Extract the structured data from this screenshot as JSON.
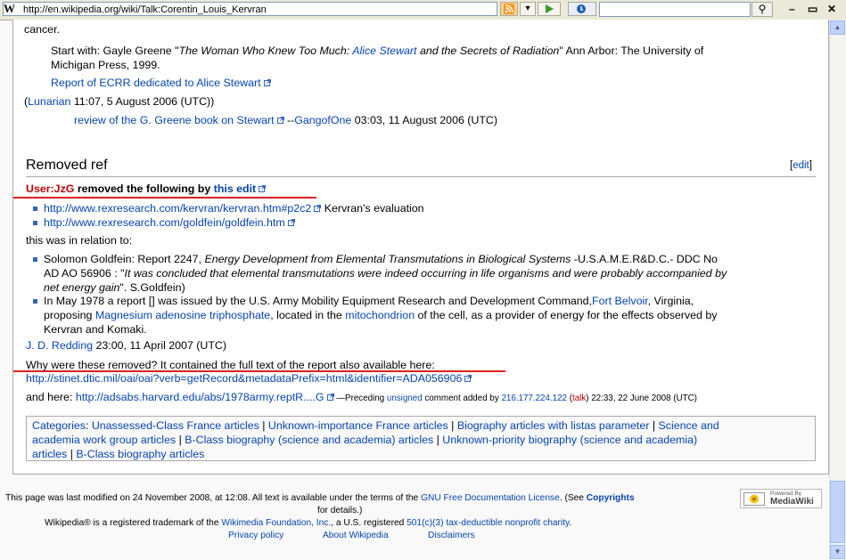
{
  "browser": {
    "url": "http://en.wikipedia.org/wiki/Talk:Corentin_Louis_Kervran",
    "favicon": "W"
  },
  "article": {
    "line_top": "cancer.",
    "start_with_prefix": "Start with: Gayle Greene \"",
    "book_title_1": "The Woman Who Knew Too Much: ",
    "alice_stewart": "Alice Stewart",
    "book_title_2": " and the Secrets of Radiation",
    "start_with_suffix": "\" Ann Arbor: The University of",
    "publisher_line": "Michigan Press, 1999.",
    "ecrr_link": "Report of ECRR dedicated to Alice Stewart",
    "sig1_open": "(",
    "sig1_user": "Lunarian",
    "sig1_rest": " 11:07, 5 August 2006 (UTC))",
    "review_link": "review of the G. Greene book on Stewart",
    "review_sep": " --",
    "review_user": "GangofOne",
    "review_time": " 03:03, 11 August 2006 (UTC)",
    "section_heading": "Removed ref",
    "edit_open": "[",
    "edit_label": "edit",
    "edit_close": "]",
    "removed_user": "User:JzG",
    "removed_text": " removed the following by ",
    "removed_link": "this edit",
    "link1": "http://www.rexresearch.com/kervran/kervran.htm#p2c2",
    "link1_suffix": " Kervran's evaluation",
    "link2": "http://www.rexresearch.com/goldfein/goldfein.htm",
    "relation": "this was in relation to:",
    "b1_l1_a": "Solomon Goldfein: Report 2247, ",
    "b1_l1_b": "Energy Development from Elemental Transmutations in Biological Systems",
    "b1_l1_c": " -U.S.A.M.E.R&D.C.- DDC No",
    "b1_l2_a": "AD AO 56906 : \"",
    "b1_l2_b": "It was concluded that elemental transmutations were indeed occurring in life organisms and were probably accompanied by",
    "b1_l3_a": "net energy gain",
    "b1_l3_b": "\". S.Goldfein)",
    "b2_l1_a": "In May 1978 a report [] was issued by the U.S. Army Mobility Equipment Research and Development Command,",
    "b2_l1_link": "Fort Belvoir",
    "b2_l1_b": ", Virginia,",
    "b2_l2_a": "proposing ",
    "b2_l2_link1": "Magnesium adenosine triphosphate",
    "b2_l2_b": ", located in the ",
    "b2_l2_link2": "mitochondrion",
    "b2_l2_c": " of the cell, as a provider of energy for the effects observed by",
    "b2_l3": "Kervran and Komaki.",
    "redding_user": "J. D. Redding",
    "redding_time": " 23:00, 11 April 2007 (UTC)",
    "why_text": "Why were these removed? It contained the full text of the report also available here:",
    "stinet_link": "http://stinet.dtic.mil/oai/oai?verb=getRecord&metadataPrefix=html&identifier=ADA056906",
    "and_here": "and here: ",
    "adsabs_link": "http://adsabs.harvard.edu/abs/1978army.reptR....G",
    "preceding": " —Preceding ",
    "unsigned": "unsigned",
    "comment_added": " comment added by ",
    "ip": "216.177.224.122",
    "talk_open": " (",
    "talk": "talk",
    "talk_close": ") 22:33, 22 June 2008 (UTC)"
  },
  "categories": {
    "label": "Categories",
    "colon": ": ",
    "line1": [
      "Unassessed-Class France articles",
      "Unknown-importance France articles",
      "Biography articles with listas parameter",
      "Science and"
    ],
    "line2": [
      "academia work group articles",
      "B-Class biography (science and academia) articles",
      "Unknown-priority biography (science and academia)"
    ],
    "line3": [
      "articles",
      "B-Class biography articles"
    ],
    "sep": " | "
  },
  "footer": {
    "l1_a": "This page was last modified on 24 November 2008, at 12:08.  All text is available under the terms of the ",
    "l1_link": "GNU Free Documentation License",
    "l1_b": ". (See ",
    "l1_bold": "Copyrights",
    "l2": "for details.)",
    "l3_a": "Wikipedia® is a registered trademark of the ",
    "l3_link1": "Wikimedia Foundation, Inc.",
    "l3_b": ", a U.S. registered ",
    "l3_link2": "501(c)(3)",
    "l3_c": " ",
    "l3_link3": "tax-deductible",
    "l3_d": " ",
    "l3_link4": "nonprofit",
    "l3_e": " ",
    "l3_link5": "charity",
    "l3_f": ".",
    "privacy": "Privacy policy",
    "about": "About Wikipedia",
    "disclaimers": "Disclaimers",
    "badge_top": "Powered By",
    "badge_main": "MediaWiki"
  },
  "colors": {
    "link": "#0645ad",
    "redlink": "#ba0000",
    "annotation_red": "#e0201f",
    "scroll_blue": "#c1d3fb"
  }
}
